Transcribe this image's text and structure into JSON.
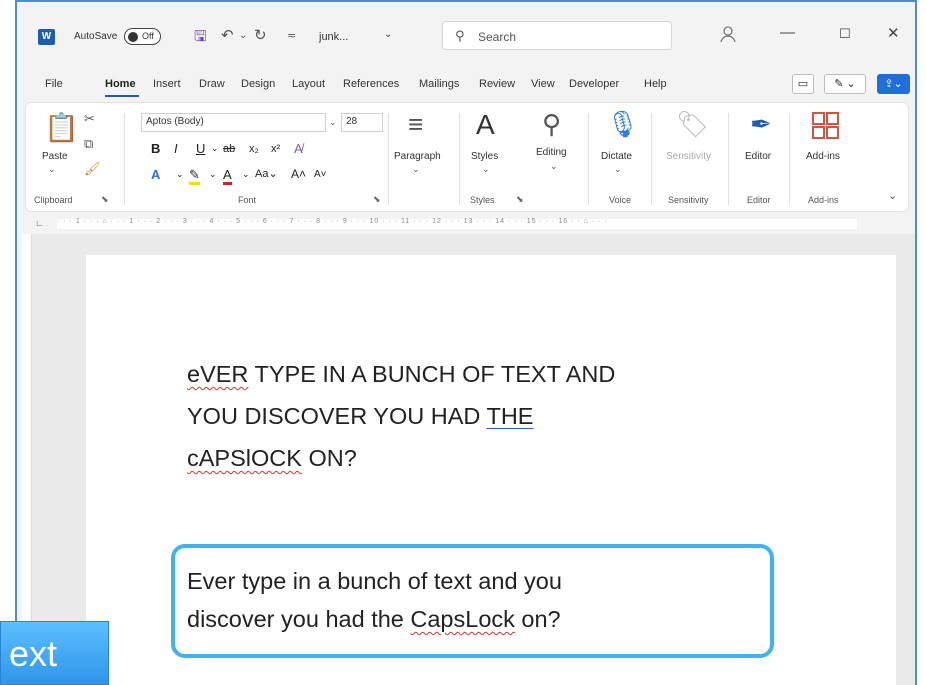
{
  "titlebar": {
    "logo": "W",
    "autosave_label": "AutoSave",
    "autosave_state": "Off",
    "doc_name": "junk...",
    "doc_chevron": "⌄",
    "search_placeholder": "Search",
    "icons": [
      "save-icon",
      "undo-icon",
      "redo-icon",
      "customize-icon"
    ]
  },
  "tabs": [
    "File",
    "Home",
    "Insert",
    "Draw",
    "Design",
    "Layout",
    "References",
    "Mailings",
    "Review",
    "View",
    "Developer",
    "Help"
  ],
  "ribbon": {
    "paste": "Paste",
    "clipboard": "Clipboard",
    "font_name": "Aptos (Body)",
    "font_size": "28",
    "font": "Font",
    "paragraph": "Paragraph",
    "styles": "Styles",
    "styles_group": "Styles",
    "editing": "Editing",
    "dictate": "Dictate",
    "voice": "Voice",
    "sensitivity": "Sensitivity",
    "sensitivity_group": "Sensitivity",
    "editor": "Editor",
    "editor_group": "Editor",
    "addins": "Add-ins",
    "addins_group": "Add-ins"
  },
  "document": {
    "line1_a": "eVER",
    "line1_b": " TYPE IN A BUNCH OF TEXT AND",
    "line2_a": "YOU DISCOVER YOU HAD ",
    "line2_b": "THE",
    "line3_a": "cAPSlOCK",
    "line3_b": " ON?",
    "fixed_a": "Ever type in a bunch of text and you",
    "fixed_b": "discover you had the ",
    "fixed_c": "CapsLock",
    "fixed_d": " on?"
  },
  "overlay_button": "ext",
  "colors": {
    "accent": "#1e5cb3",
    "highlight_border": "#3fb3f0",
    "overlay": "#3aa3f0"
  }
}
